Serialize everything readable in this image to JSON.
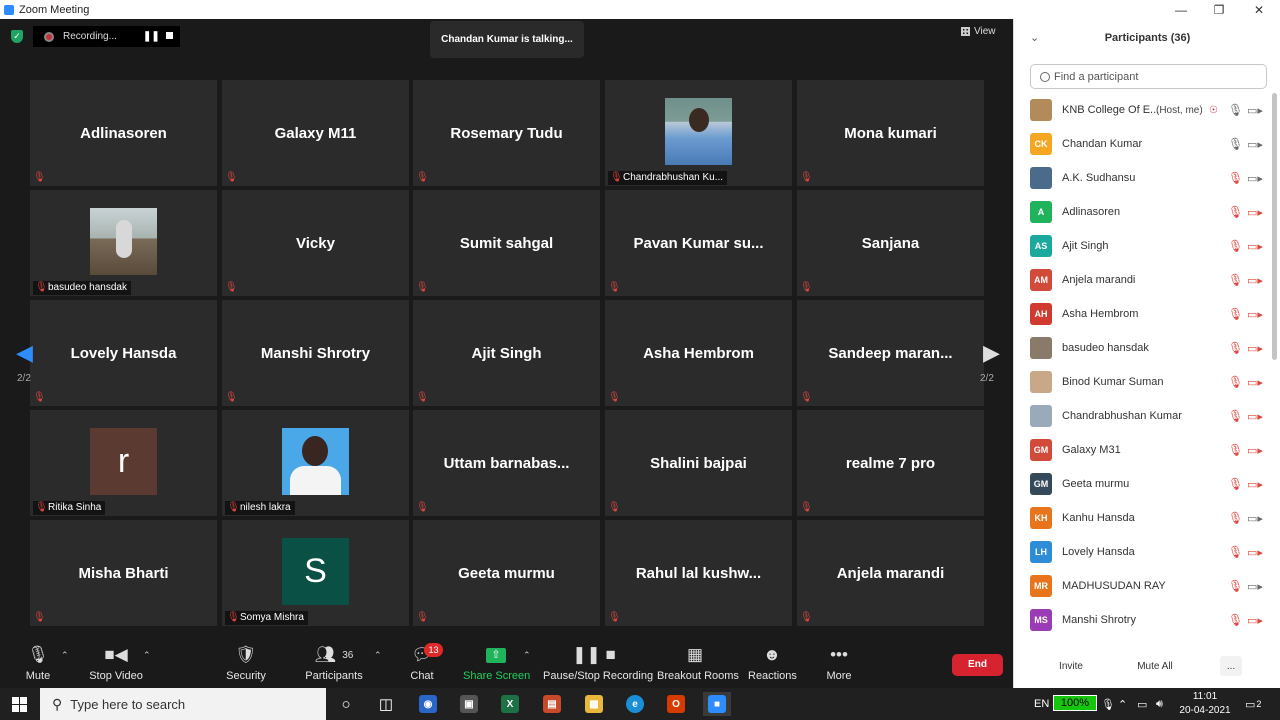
{
  "window": {
    "title": "Zoom Meeting"
  },
  "recording": {
    "label": "Recording..."
  },
  "talking_banner": "Chandan Kumar is talking...",
  "view_label": "View",
  "page_indicator": {
    "left": "2/2",
    "right": "2/2"
  },
  "tiles": [
    {
      "name": "Adlinasoren"
    },
    {
      "name": "Galaxy M11"
    },
    {
      "name": "Rosemary Tudu"
    },
    {
      "name": "Chandrabhushan Ku..."
    },
    {
      "name": "Mona kumari"
    },
    {
      "name": "basudeo hansdak"
    },
    {
      "name": "Vicky"
    },
    {
      "name": "Sumit sahgal"
    },
    {
      "name": "Pavan Kumar su..."
    },
    {
      "name": "Sanjana"
    },
    {
      "name": "Lovely Hansda"
    },
    {
      "name": "Manshi Shrotry"
    },
    {
      "name": "Ajit Singh"
    },
    {
      "name": "Asha Hembrom"
    },
    {
      "name": "Sandeep maran..."
    },
    {
      "name": "Ritika Sinha",
      "initial": "r"
    },
    {
      "name": "nilesh lakra"
    },
    {
      "name": "Uttam barnabas..."
    },
    {
      "name": "Shalini bajpai"
    },
    {
      "name": "realme 7 pro"
    },
    {
      "name": "Misha Bharti"
    },
    {
      "name": "Somya Mishra",
      "initial": "S"
    },
    {
      "name": "Geeta murmu"
    },
    {
      "name": "Rahul lal kushw..."
    },
    {
      "name": "Anjela marandi"
    }
  ],
  "toolbar": {
    "mute": "Mute",
    "stop_video": "Stop Video",
    "security": "Security",
    "participants": "Participants",
    "participants_count": "36",
    "chat": "Chat",
    "chat_badge": "13",
    "share_screen": "Share Screen",
    "pause_stop_recording": "Pause/Stop Recording",
    "breakout_rooms": "Breakout Rooms",
    "reactions": "Reactions",
    "more": "More",
    "end": "End"
  },
  "panel": {
    "title": "Participants (36)",
    "search_placeholder": "Find a participant",
    "participants": [
      {
        "initials": "",
        "name": "KNB College Of E...",
        "tag": "(Host, me)",
        "color": "#b38a5a"
      },
      {
        "initials": "CK",
        "name": "Chandan Kumar",
        "color": "#f5a623"
      },
      {
        "initials": "",
        "name": "A.K. Sudhansu",
        "color": "#4a6b8a"
      },
      {
        "initials": "A",
        "name": "Adlinasoren",
        "color": "#1fb35c"
      },
      {
        "initials": "AS",
        "name": "Ajit Singh",
        "color": "#1aa99c"
      },
      {
        "initials": "AM",
        "name": "Anjela marandi",
        "color": "#d14a3a"
      },
      {
        "initials": "AH",
        "name": "Asha Hembrom",
        "color": "#d13b2f"
      },
      {
        "initials": "",
        "name": "basudeo hansdak",
        "color": "#8a7a6a"
      },
      {
        "initials": "",
        "name": "Binod Kumar Suman",
        "color": "#c8a888"
      },
      {
        "initials": "",
        "name": "Chandrabhushan Kumar",
        "color": "#9aaabb"
      },
      {
        "initials": "GM",
        "name": "Galaxy M31",
        "color": "#d14a3a"
      },
      {
        "initials": "GM",
        "name": "Geeta murmu",
        "color": "#344a5a"
      },
      {
        "initials": "KH",
        "name": "Kanhu Hansda",
        "color": "#e8741c"
      },
      {
        "initials": "LH",
        "name": "Lovely Hansda",
        "color": "#2d8cd6"
      },
      {
        "initials": "MR",
        "name": "MADHUSUDAN RAY",
        "color": "#e8741c"
      },
      {
        "initials": "MS",
        "name": "Manshi Shrotry",
        "color": "#9b3bb5"
      }
    ],
    "invite": "Invite",
    "mute_all": "Mute All",
    "more": "..."
  },
  "taskbar": {
    "search_placeholder": "Type here to search",
    "lang": "EN",
    "battery": "100%",
    "time": "11:01",
    "date": "20-04-2021",
    "notifications": "2"
  }
}
